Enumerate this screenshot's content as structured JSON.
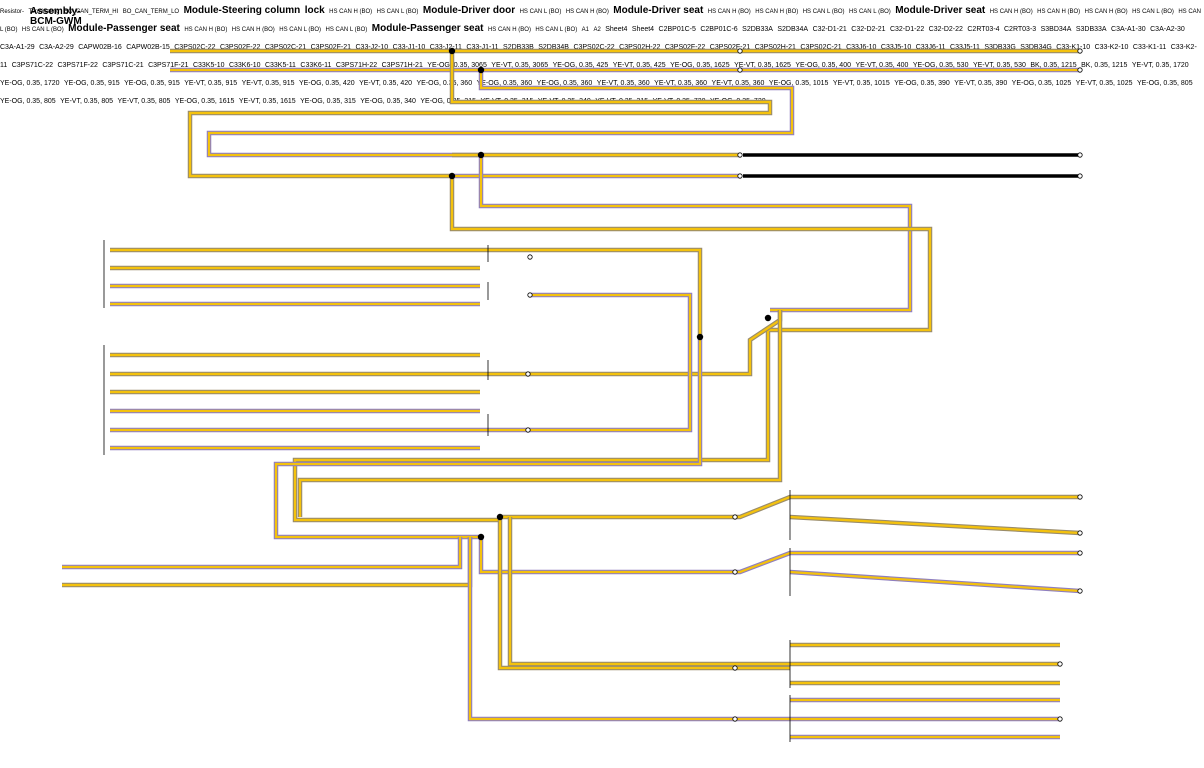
{
  "colors": {
    "ye": "#f4c20d",
    "og_stripe": "#9a8c6a",
    "vt_stripe": "#8f7fbf",
    "bk": "#000000",
    "label_blue": "#1a1aff"
  },
  "bcm": {
    "title": "Assembly-BCM-GWM",
    "resistor_label": "Resistor-Terminating",
    "pins": [
      "BO_CAN_TERM_HI",
      "BO_CAN_TERM_LO"
    ]
  },
  "steering": {
    "title": "Module-Steering column lock",
    "pins": [
      "HS CAN H (BO)",
      "HS CAN L (BO)"
    ]
  },
  "driver_door": {
    "title": "Module-Driver door",
    "pins": [
      "HS CAN L (BO)",
      "HS CAN H (BO)"
    ]
  },
  "seat1": {
    "title": "Module-Driver seat",
    "pins": [
      "HS CAN H (BO)",
      "HS CAN H (BO)",
      "HS CAN L (BO)",
      "HS CAN L (BO)"
    ]
  },
  "seat2": {
    "title": "Module-Driver seat",
    "pins": [
      "HS CAN H (BO)",
      "HS CAN H (BO)",
      "HS CAN H (BO)",
      "HS CAN L (BO)",
      "HS CAN L (BO)",
      "HS CAN L (BO)"
    ]
  },
  "pass1": {
    "title": "Module-Passenger seat",
    "pins": [
      "HS CAN H (BO)",
      "HS CAN H (BO)",
      "HS CAN L (BO)",
      "HS CAN L (BO)"
    ]
  },
  "pass2": {
    "title": "Module-Passenger seat",
    "pins": [
      "HS CAN H (BO)",
      "HS CAN L (BO)"
    ]
  },
  "offsheet": [
    {
      "pin": "A1",
      "ref": "Sheet4",
      "wire": "YE-VT,  0.35,  720"
    },
    {
      "pin": "A2",
      "ref": "Sheet4",
      "wire": "YE-OG,  0.35,  720"
    }
  ],
  "connectors": [
    "C2BP01C-5",
    "C2BP01C-6",
    "S2DB33A",
    "S2DB34A",
    "C32-D1-21",
    "C32-D2-21",
    "C32-D1-22",
    "C32-D2-22",
    "C2RT03-4",
    "C2RT03-3",
    "S3BD34A",
    "S3DB33A",
    "C3A-A1-30",
    "C3A-A2-30",
    "C3A-A1-29",
    "C3A-A2-29",
    "CAPW02B-16",
    "CAPW02B-15",
    "C3PS02C-22",
    "C3PS02F-22",
    "C3PS02C-21",
    "C3PS02F-21",
    "C33-J2-10",
    "C33-J1-10",
    "C33-J2-11",
    "C33-J1-11",
    "S2DB33B",
    "S2DB34B",
    "C3PS02C-22",
    "C3PS02H-22",
    "C3PS02F-22",
    "C3PS02F-21",
    "C3PS02H-21",
    "C3PS02C-21",
    "C33J6-10",
    "C33J5-10",
    "C33J6-11",
    "C33J5-11",
    "S3DB33G",
    "S3DB34G",
    "C33-K1-10",
    "C33-K2-10",
    "C33-K1-11",
    "C33-K2-11",
    "C3PS71C-22",
    "C3PS71F-22",
    "C3PS71C-21",
    "C3PS71F-21",
    "C33K5-10",
    "C33K6-10",
    "C33K5-11",
    "C33K6-11",
    "C3PS71H-22",
    "C3PS71H-21"
  ],
  "wires": [
    "YE-OG,  0.35,  3065",
    "YE-VT,  0.35,  3065",
    "YE-OG,  0.35,  425",
    "YE-VT,  0.35,  425",
    "YE-OG,  0.35,  1625",
    "YE-VT,  0.35,  1625",
    "YE-OG,  0.35,  400",
    "YE-VT,  0.35,  400",
    "YE-OG,  0.35,  530",
    "YE-VT,  0.35,  530",
    "BK,  0.35,  1215",
    "BK,  0.35,  1215",
    "YE-VT,  0.35,  1720",
    "YE-OG,  0.35,  1720",
    "YE-OG,  0.35,  915",
    "YE-OG,  0.35,  915",
    "YE-VT,  0.35,  915",
    "YE-VT,  0.35,  915",
    "YE-OG,  0.35,  420",
    "YE-VT,  0.35,  420",
    "YE-OG,  0.35,  360",
    "YE-OG,  0.35,  360",
    "YE-OG,  0.35,  360",
    "YE-VT,  0.35,  360",
    "YE-VT,  0.35,  360",
    "YE-VT,  0.35,  360",
    "YE-OG,  0.35,  1015",
    "YE-VT,  0.35,  1015",
    "YE-OG,  0.35,  390",
    "YE-VT,  0.35,  390",
    "YE-OG,  0.35,  1025",
    "YE-VT,  0.35,  1025",
    "YE-OG,  0.35,  805",
    "YE-OG,  0.35,  805",
    "YE-VT,  0.35,  805",
    "YE-VT,  0.35,  805",
    "YE-OG,  0.35,  1615",
    "YE-VT,  0.35,  1615",
    "YE-OG,  0.35,  315",
    "YE-OG,  0.35,  340",
    "YE-OG,  0.35,  315",
    "YE-VT,  0.35,  315",
    "YE-VT,  0.35,  340",
    "YE-VT,  0.35,  315"
  ]
}
